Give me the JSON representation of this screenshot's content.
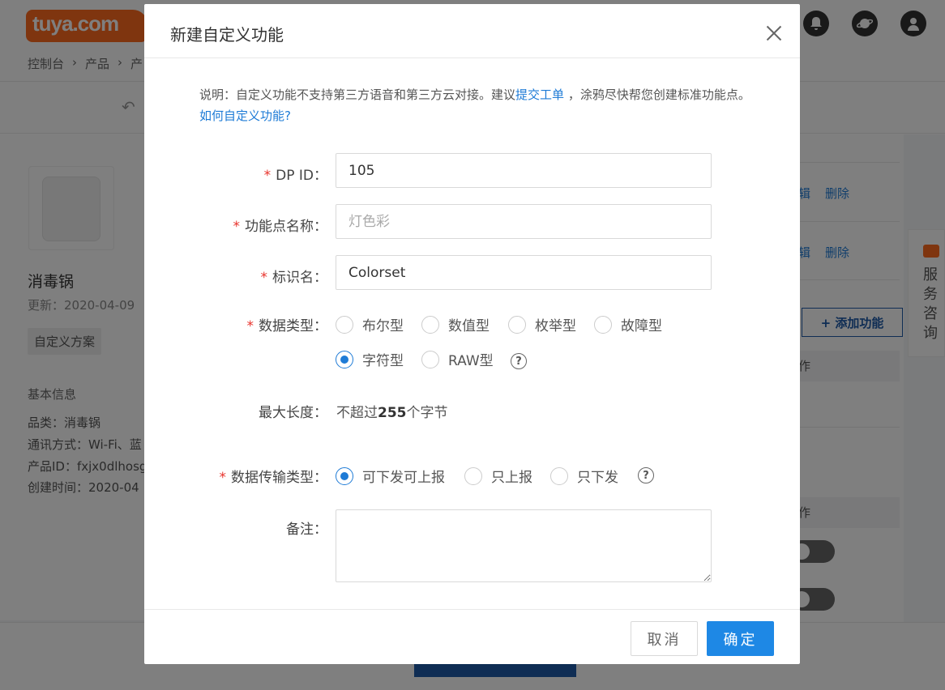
{
  "background": {
    "logo_text": "tuya.com",
    "breadcrumb": [
      "控制台",
      "›",
      "产品",
      "›",
      "产"
    ],
    "product_name": "消毒锅",
    "update_date": "更新：2020-04-09",
    "tag": "自定义方案",
    "basic_info_title": "基本信息",
    "info": {
      "category": "品类：消毒锅",
      "comm": "通讯方式：Wi-Fi、蓝",
      "pid": "产品ID：fxjx0dlhosg",
      "created": "创建时间：2020-04"
    },
    "right": {
      "edit1": "辑",
      "del1": "删除",
      "edit2": "辑",
      "del2": "删除",
      "add_function": "+ 添加功能",
      "th1": "作",
      "th2": "作",
      "top_partial": "编辑  删除"
    },
    "service_label": "服务咨询"
  },
  "modal": {
    "title": "新建自定义功能",
    "desc_part1": "说明：自定义功能不支持第三方语音和第三方云对接。建议",
    "desc_link1": "提交工单",
    "desc_part2": "，涂鸦尽快帮您创建标准功能点。",
    "desc_link2": "如何自定义功能?",
    "fields": {
      "dpid": {
        "label": "DP ID：",
        "value": "105"
      },
      "name": {
        "label": "功能点名称：",
        "placeholder": "灯色彩"
      },
      "identifier": {
        "label": "标识名：",
        "value": "Colorset"
      },
      "data_type": {
        "label": "数据类型：",
        "options": [
          "布尔型",
          "数值型",
          "枚举型",
          "故障型",
          "字符型",
          "RAW型"
        ],
        "selected": "字符型"
      },
      "max_length": {
        "label": "最大长度：",
        "prefix": "不超过",
        "number": "255",
        "suffix": "个字节"
      },
      "transfer_type": {
        "label": "数据传输类型：",
        "options": [
          "可下发可上报",
          "只上报",
          "只下发"
        ],
        "selected": "可下发可上报"
      },
      "remark": {
        "label": "备注：",
        "value": ""
      }
    },
    "required_mark": "*",
    "help_icon": "?",
    "cancel": "取消",
    "ok": "确定"
  }
}
